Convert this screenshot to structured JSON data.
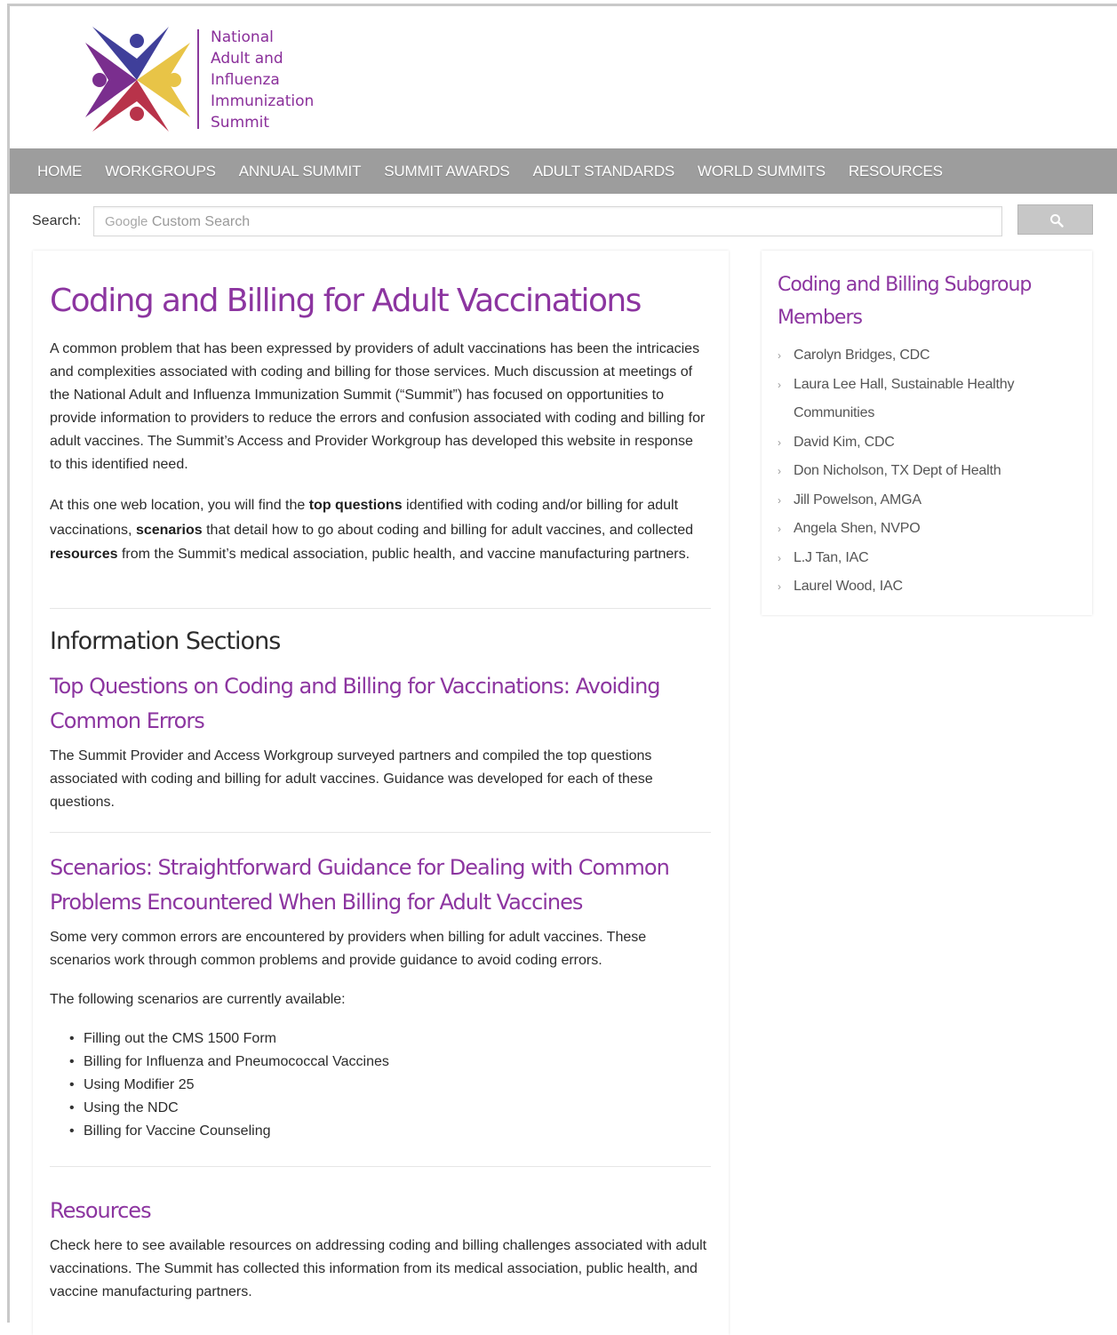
{
  "logo": {
    "lines": [
      "National",
      "Adult and",
      "Influenza",
      "Immunization",
      "Summit"
    ],
    "colors": {
      "purple": "#7a2e8e",
      "indigo": "#3f3f9a",
      "gold": "#e8c447",
      "crimson": "#b8334a"
    }
  },
  "nav": {
    "items": [
      "HOME",
      "WORKGROUPS",
      "ANNUAL SUMMIT",
      "SUMMIT AWARDS",
      "ADULT STANDARDS",
      "WORLD SUMMITS",
      "RESOURCES"
    ]
  },
  "search": {
    "label": "Search:",
    "placeholder_brand": "Google",
    "placeholder_text": "Custom Search",
    "button_icon": "search-icon"
  },
  "main": {
    "title": "Coding and Billing for Adult Vaccinations",
    "intro": "A common problem that has been expressed by providers of adult vaccinations has been the intricacies and complexities associated with coding and billing for those services. Much discussion at meetings of the National Adult and Influenza Immunization Summit (“Summit”) has focused on opportunities to provide information to providers to reduce the errors and confusion associated with coding and billing for adult vaccines. The Summit’s Access and Provider Workgroup has developed this website in response to this identified need.",
    "location_para": {
      "t1": "At this one web location, you will find the ",
      "b1": "top questions",
      "t2": " identified with coding and/or billing for adult vaccinations, ",
      "b2": "scenarios",
      "t3": " that detail how to go about coding and billing for adult vaccines, and collected ",
      "b3": "resources",
      "t4": " from the Summit’s medical association, public health, and vaccine manufacturing partners."
    },
    "sections_heading": "Information Sections",
    "top_questions": {
      "heading": "Top Questions on Coding and Billing for Vaccinations: Avoiding Common Errors",
      "body": "The Summit Provider and Access Workgroup surveyed partners and compiled the top questions associated with coding and billing for adult vaccines. Guidance was developed for each of these questions."
    },
    "scenarios": {
      "heading": "Scenarios: Straightforward Guidance for Dealing with Common Problems Encountered When Billing for Adult Vaccines",
      "body": "Some very common errors are encountered by providers when billing for adult vaccines. These scenarios work through common problems and provide guidance to avoid coding errors.",
      "available_label": "The following scenarios are currently available:",
      "items": [
        "Filling out the CMS 1500 Form",
        "Billing for Influenza and Pneumococcal Vaccines",
        "Using Modifier 25",
        "Using the NDC",
        "Billing for Vaccine Counseling"
      ]
    },
    "resources": {
      "heading": "Resources",
      "body": "Check here to see available resources on addressing coding and billing challenges associated with adult vaccinations. The Summit has collected this information from its medical association, public health, and vaccine manufacturing partners."
    }
  },
  "sidebar": {
    "title": "Coding and Billing Subgroup Members",
    "members": [
      "Carolyn Bridges, CDC",
      "Laura Lee Hall, Sustainable Healthy Communities",
      "David Kim, CDC",
      "Don Nicholson, TX Dept of Health",
      "Jill Powelson, AMGA",
      "Angela Shen, NVPO",
      "L.J Tan, IAC",
      "Laurel Wood, IAC"
    ]
  },
  "colors": {
    "accent_purple": "#8c35a0",
    "nav_gray": "#9d9d9d",
    "text": "#2b2b2b"
  }
}
